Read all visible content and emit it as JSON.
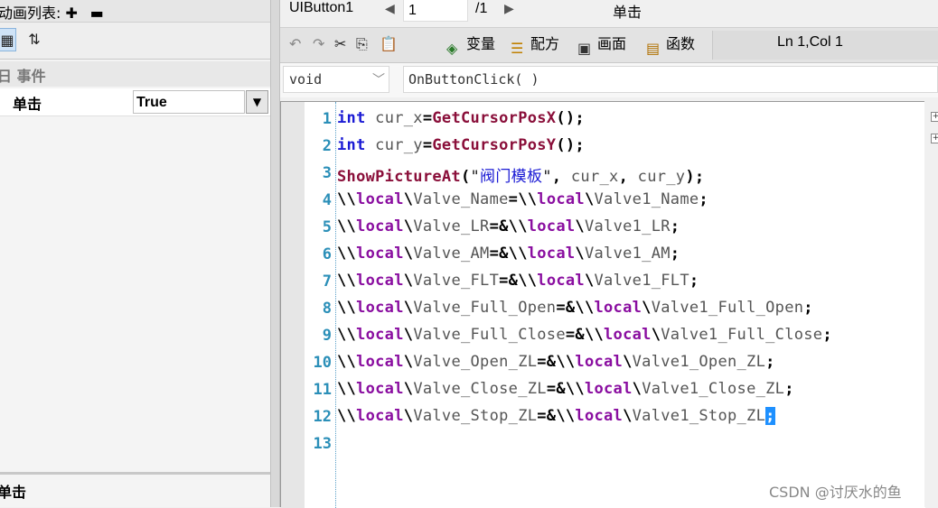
{
  "left_panel": {
    "title": "动画列表: ",
    "title_icons": [
      "plus-icon",
      "minus-icon"
    ],
    "category": "日 事件",
    "property": {
      "name": "单击",
      "value": "True"
    },
    "description_title": "单击"
  },
  "header": {
    "object_name": "UIButton1",
    "page_current": "1",
    "page_total": "/1",
    "event_title": "单击"
  },
  "toolbar": {
    "variables_label": "变量",
    "recipe_label": "配方",
    "screen_label": "画面",
    "functions_label": "函数",
    "cursor_position": "Ln 1,Col 1"
  },
  "signature": {
    "return_type": "void",
    "function_name": "OnButtonClick( )"
  },
  "code": {
    "line_numbers": [
      "1",
      "2",
      "3",
      "4",
      "5",
      "6",
      "7",
      "8",
      "9",
      "10",
      "11",
      "12",
      "13"
    ]
  },
  "watermark": "CSDN @讨厌水的鱼",
  "colors": {
    "keyword": "#1a1ad4",
    "function": "#8a0f3a",
    "local_path": "#8a0ea0",
    "line_number": "#2b8fb8",
    "selection": "#1e90ff"
  }
}
